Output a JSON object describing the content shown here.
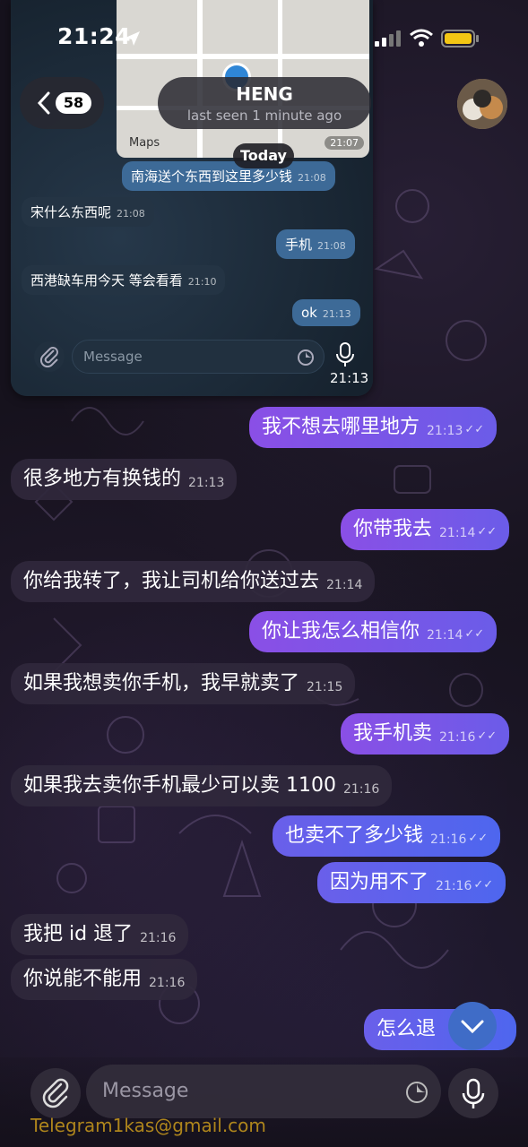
{
  "status_bar": {
    "time": "21:24"
  },
  "header": {
    "back_badge": "58",
    "contact_name": "HENG",
    "contact_status": "last seen 1 minute ago"
  },
  "date_chip": "Today",
  "inset": {
    "maps_label": "Maps",
    "map_time": "21:07",
    "messages": [
      {
        "text": "南海送个东西到这里多少钱",
        "time": "21:08",
        "dir": "out"
      },
      {
        "text": "宋什么东西呢",
        "time": "21:08",
        "dir": "in"
      },
      {
        "text": "手机",
        "time": "21:08",
        "dir": "out"
      },
      {
        "text": "西港缺车用今天 等会看看",
        "time": "21:10",
        "dir": "in"
      },
      {
        "text": "ok",
        "time": "21:13",
        "dir": "out"
      }
    ],
    "input_placeholder": "Message",
    "record_time": "21:13"
  },
  "messages": [
    {
      "text": "我不想去哪里地方",
      "time": "21:13",
      "dir": "out"
    },
    {
      "text": "很多地方有换钱的",
      "time": "21:13",
      "dir": "in"
    },
    {
      "text": "你带我去",
      "time": "21:14",
      "dir": "out"
    },
    {
      "text": "你给我转了，我让司机给你送过去",
      "time": "21:14",
      "dir": "in"
    },
    {
      "text": "你让我怎么相信你",
      "time": "21:14",
      "dir": "out"
    },
    {
      "text": "如果我想卖你手机，我早就卖了",
      "time": "21:15",
      "dir": "in"
    },
    {
      "text": "我手机卖",
      "time": "21:16",
      "dir": "out"
    },
    {
      "text": "如果我去卖你手机最少可以卖 1100",
      "time": "21:16",
      "dir": "in"
    },
    {
      "text": "也卖不了多少钱",
      "time": "21:16",
      "dir": "out"
    },
    {
      "text": "因为用不了",
      "time": "21:16",
      "dir": "out"
    },
    {
      "text": "我把 id 退了",
      "time": "21:16",
      "dir": "in"
    },
    {
      "text": "你说能不能用",
      "time": "21:16",
      "dir": "in"
    },
    {
      "text": "怎么退",
      "time": "",
      "dir": "out"
    }
  ],
  "input": {
    "placeholder": "Message"
  },
  "watermark": "Telegram1kas@gmail.com",
  "colors": {
    "outgoing": "#8a4fe6",
    "outgoing_blue": "#4e66ee",
    "incoming": "#30283c",
    "accent": "#3f6cc7"
  }
}
